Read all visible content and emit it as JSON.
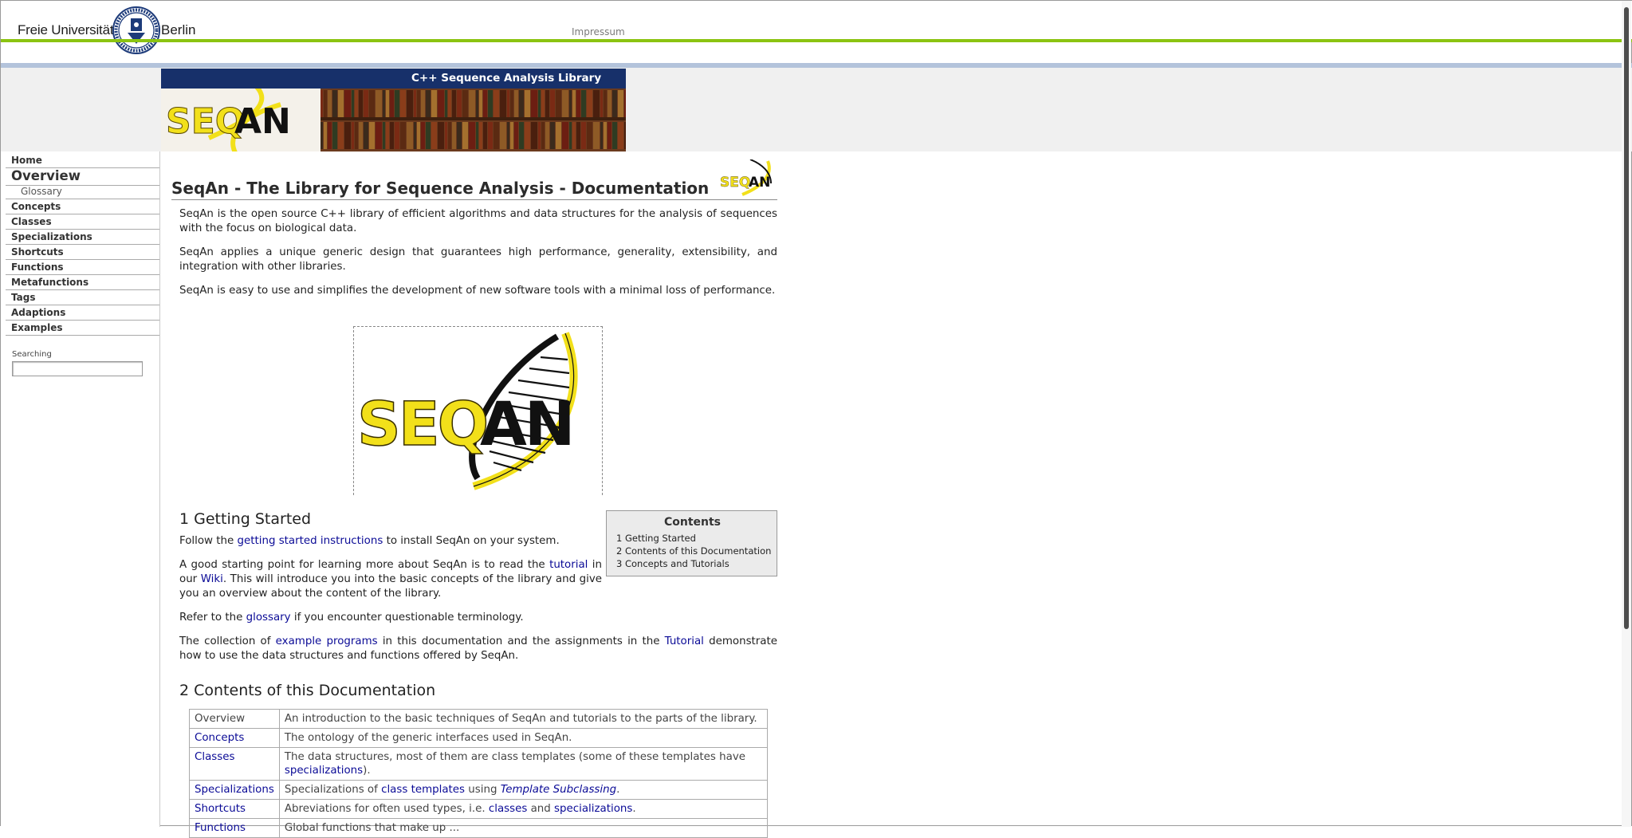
{
  "header": {
    "university_left": "Freie Universität",
    "university_right": "Berlin",
    "impressum": "Impressum"
  },
  "banner": {
    "title": "C++ Sequence Analysis Library",
    "logo_text": "SEQAN"
  },
  "sidebar": {
    "items": [
      {
        "label": "Home"
      },
      {
        "label": "Overview"
      },
      {
        "label": "Glossary"
      },
      {
        "label": "Concepts"
      },
      {
        "label": "Classes"
      },
      {
        "label": "Specializations"
      },
      {
        "label": "Shortcuts"
      },
      {
        "label": "Functions"
      },
      {
        "label": "Metafunctions"
      },
      {
        "label": "Tags"
      },
      {
        "label": "Adaptions"
      },
      {
        "label": "Examples"
      }
    ],
    "search_label": "Searching",
    "search_value": ""
  },
  "main": {
    "title": "SeqAn - The Library for Sequence Analysis - Documentation",
    "intro": [
      "SeqAn is the open source C++ library of efficient algorithms and data structures for the analysis of sequences with the focus on biological data.",
      "SeqAn applies a unique generic design that guarantees high performance, generality, extensibility, and integration with other libraries.",
      "SeqAn is easy to use and simplifies the development of new software tools with a minimal loss of performance."
    ],
    "section1": {
      "heading": "1 Getting Started",
      "p1": {
        "pre": "Follow the ",
        "link": "getting started instructions",
        "post": " to install SeqAn on your system."
      },
      "p2": {
        "pre": "A good starting point for learning more about SeqAn is to read the ",
        "link1": "tutorial",
        "mid1": " in our ",
        "link2": "Wiki",
        "post": ". This will introduce you into the basic concepts of the library and give you an overview about the content of the library."
      },
      "p3": {
        "pre": "Refer to the ",
        "link": "glossary",
        "post": " if you encounter questionable terminology."
      },
      "p4": {
        "pre": "The collection of ",
        "link1": "example programs",
        "mid": " in this documentation and the assignments in the ",
        "link2": "Tutorial",
        "post": " demonstrate how to use the data structures and functions offered by SeqAn."
      }
    },
    "section2": {
      "heading": "2 Contents of this Documentation",
      "rows": [
        {
          "key": "Overview",
          "text": "An introduction to the basic techniques of SeqAn and tutorials to the parts of the library."
        },
        {
          "key": "Concepts",
          "text": "The ontology of the generic interfaces used in SeqAn."
        },
        {
          "key": "Classes",
          "text_pre": "The data structures, most of them are class templates (some of these templates have ",
          "text_link": "specializations",
          "text_post": ")."
        },
        {
          "key": "Specializations",
          "text_pre": "Specializations of ",
          "text_link": "class templates",
          "text_mid": " using ",
          "text_link2": "Template Subclassing",
          "text_post": "."
        },
        {
          "key": "Shortcuts",
          "text_pre": "Abreviations for often used types, i.e. ",
          "text_link": "classes",
          "text_mid": " and ",
          "text_link2": "specializations",
          "text_post": "."
        },
        {
          "key": "Functions",
          "text": "Global functions that make up ..."
        }
      ]
    },
    "toc": {
      "title": "Contents",
      "items": [
        "1 Getting Started",
        "2 Contents of this Documentation",
        "3 Concepts and Tutorials"
      ]
    }
  },
  "colors": {
    "accent_green": "#8bc411",
    "banner_blue": "#17306a",
    "link_blue": "#0a0a96",
    "logo_yellow": "#f2e01a"
  }
}
